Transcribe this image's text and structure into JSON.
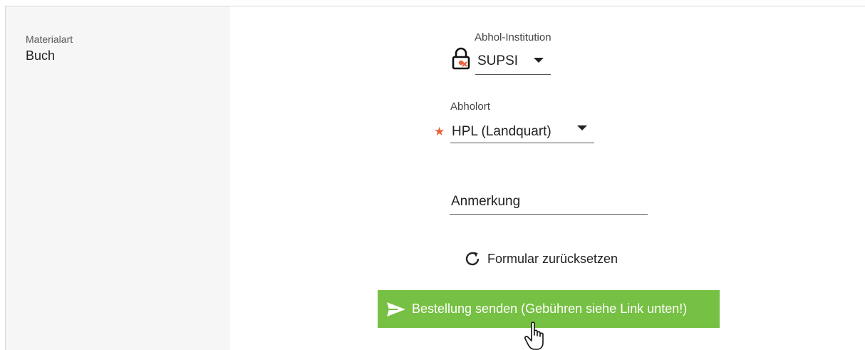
{
  "details": {
    "material_label": "Materialart",
    "material_value": "Buch"
  },
  "form": {
    "institution": {
      "label": "Abhol-Institution",
      "value": "SUPSI",
      "icon": "lock-icon"
    },
    "pickup_location": {
      "label": "Abholort",
      "value": "HPL (Landquart)",
      "required_marker": "★"
    },
    "note": {
      "label": "Anmerkung"
    },
    "reset_label": "Formular zurücksetzen",
    "submit_label": "Bestellung senden (Gebühren siehe Link unten!)"
  },
  "colors": {
    "submit_bg": "#76c043",
    "required": "#e8623a",
    "sidebar_bg": "#f6f6f6"
  }
}
